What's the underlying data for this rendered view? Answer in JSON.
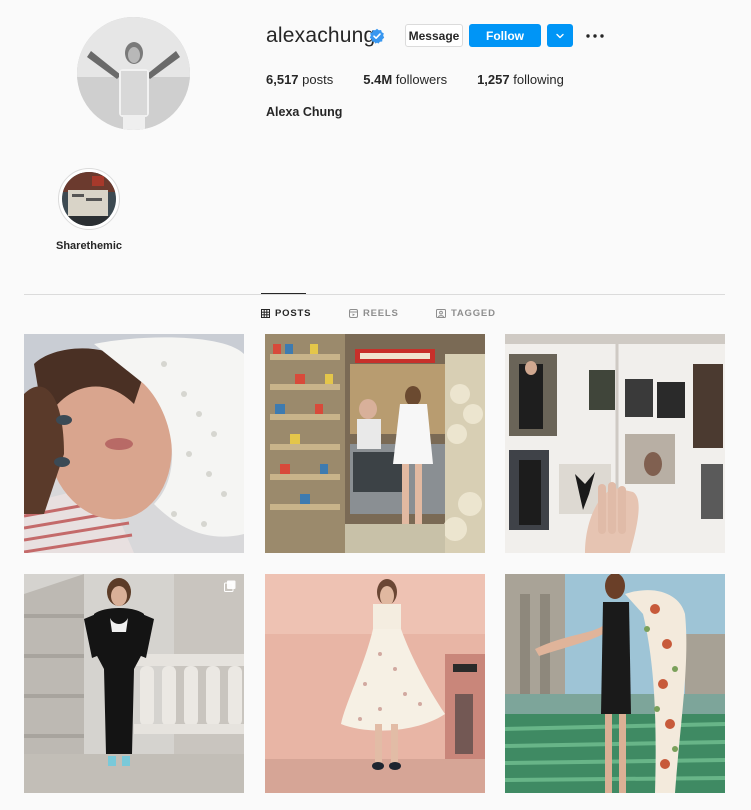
{
  "profile": {
    "username": "alexachung",
    "full_name": "Alexa Chung",
    "verified": true
  },
  "actions": {
    "message_label": "Message",
    "follow_label": "Follow",
    "dropdown_icon": "chevron-down-icon",
    "more_icon": "more-options-icon"
  },
  "stats": {
    "posts_count": "6,517",
    "posts_label": "posts",
    "followers_count": "5.4M",
    "followers_label": "followers",
    "following_count": "1,257",
    "following_label": "following"
  },
  "highlights": [
    {
      "label": "Sharethemic"
    }
  ],
  "tabs": [
    {
      "label": "POSTS",
      "icon": "grid-icon",
      "active": true
    },
    {
      "label": "REELS",
      "icon": "reels-icon",
      "active": false
    },
    {
      "label": "TAGGED",
      "icon": "tagged-icon",
      "active": false
    }
  ],
  "posts": [
    {
      "description": "selfie lying down in white eyelet top",
      "multi": false
    },
    {
      "description": "woman at a pharmacy counter",
      "multi": false
    },
    {
      "description": "open photo book spread",
      "multi": false
    },
    {
      "description": "black velvet gown on stone balcony",
      "multi": true
    },
    {
      "description": "white floral sundress against pink wall",
      "multi": false
    },
    {
      "description": "black dress with floral scarf on rooftop",
      "multi": false
    }
  ],
  "colors": {
    "accent": "#0095f6",
    "text": "#262626",
    "muted": "#8e8e8e",
    "border": "#dbdbdb",
    "background": "#fafafa"
  }
}
